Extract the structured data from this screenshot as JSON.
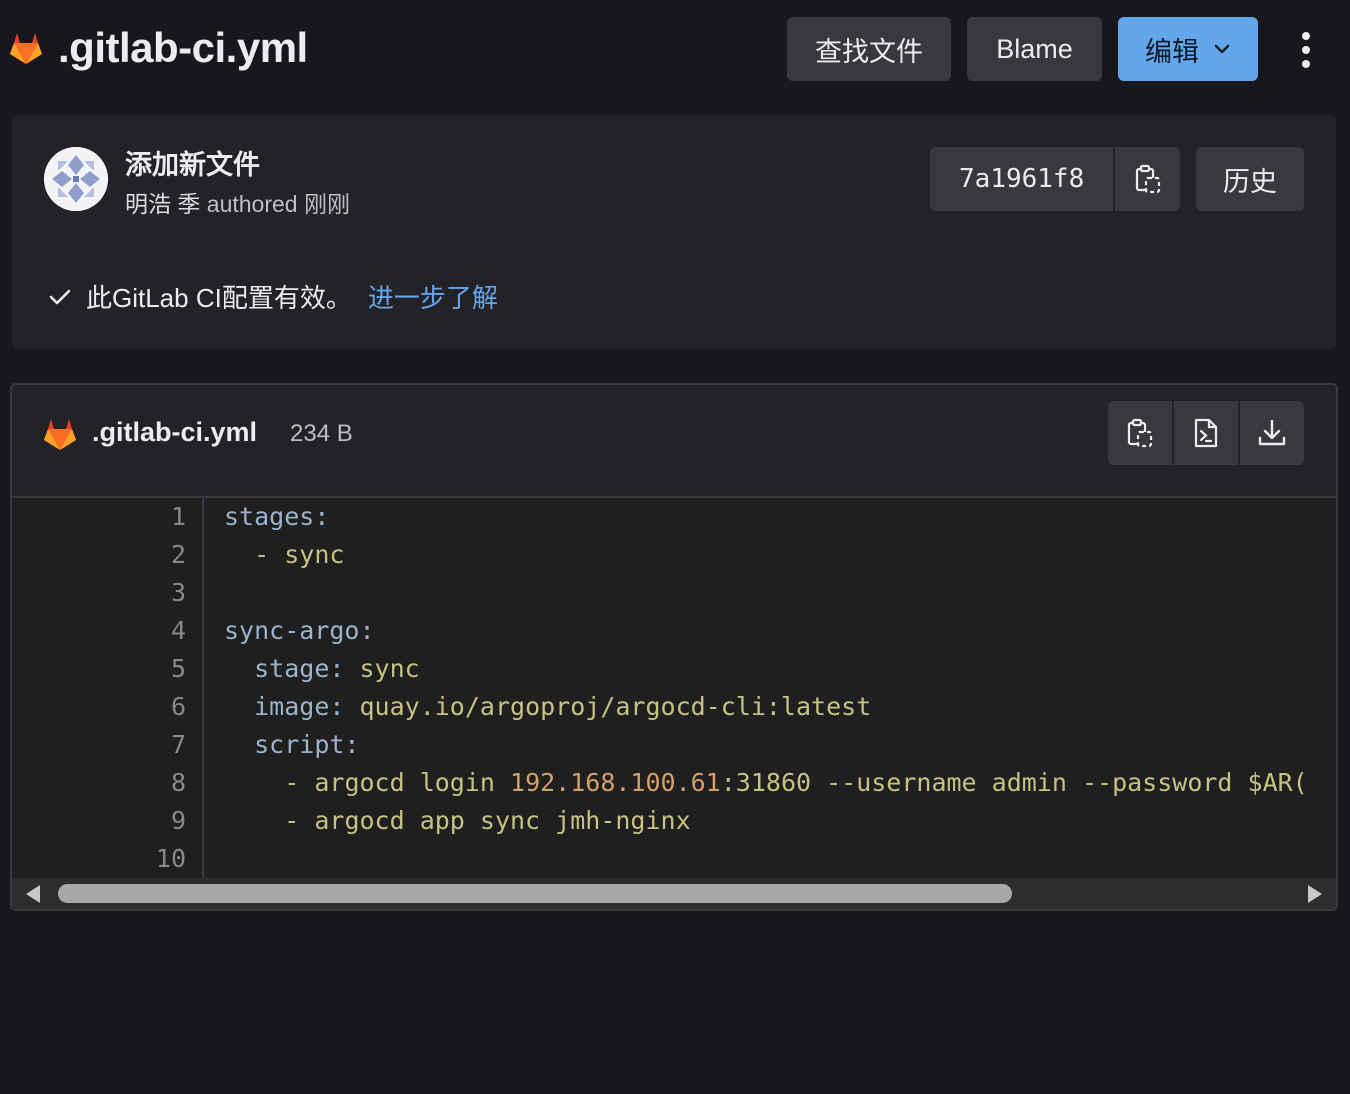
{
  "header": {
    "file_name": ".gitlab-ci.yml",
    "find_file_label": "查找文件",
    "blame_label": "Blame",
    "edit_label": "编辑"
  },
  "commit": {
    "title": "添加新文件",
    "author": "明浩 季",
    "authored_word": "authored",
    "time": "刚刚",
    "sha": "7a1961f8",
    "history_label": "历史"
  },
  "ci_status": {
    "message": "此GitLab CI配置有效。",
    "link_label": "进一步了解"
  },
  "file": {
    "name": ".gitlab-ci.yml",
    "size": "234 B",
    "line_numbers": [
      "1",
      "2",
      "3",
      "4",
      "5",
      "6",
      "7",
      "8",
      "9",
      "10"
    ],
    "lines": [
      [
        {
          "t": "key",
          "v": "stages"
        },
        {
          "t": "key",
          "v": ":"
        }
      ],
      [
        {
          "t": "plain",
          "v": "  "
        },
        {
          "t": "punct",
          "v": "-"
        },
        {
          "t": "plain",
          "v": " "
        },
        {
          "t": "str",
          "v": "sync"
        }
      ],
      [],
      [
        {
          "t": "key",
          "v": "sync-argo"
        },
        {
          "t": "key",
          "v": ":"
        }
      ],
      [
        {
          "t": "plain",
          "v": "  "
        },
        {
          "t": "key",
          "v": "stage"
        },
        {
          "t": "key",
          "v": ":"
        },
        {
          "t": "plain",
          "v": " "
        },
        {
          "t": "str",
          "v": "sync"
        }
      ],
      [
        {
          "t": "plain",
          "v": "  "
        },
        {
          "t": "key",
          "v": "image"
        },
        {
          "t": "key",
          "v": ":"
        },
        {
          "t": "plain",
          "v": " "
        },
        {
          "t": "str",
          "v": "quay.io/argoproj/argocd-cli:latest"
        }
      ],
      [
        {
          "t": "plain",
          "v": "  "
        },
        {
          "t": "key",
          "v": "script"
        },
        {
          "t": "key",
          "v": ":"
        }
      ],
      [
        {
          "t": "plain",
          "v": "    "
        },
        {
          "t": "punct",
          "v": "-"
        },
        {
          "t": "plain",
          "v": " "
        },
        {
          "t": "str",
          "v": "argocd login "
        },
        {
          "t": "num",
          "v": "192.168.100.61"
        },
        {
          "t": "str",
          "v": ":31860 --username admin --password $AR("
        }
      ],
      [
        {
          "t": "plain",
          "v": "    "
        },
        {
          "t": "punct",
          "v": "-"
        },
        {
          "t": "plain",
          "v": " "
        },
        {
          "t": "str",
          "v": "argocd app sync jmh-nginx"
        }
      ],
      []
    ]
  },
  "icons": {
    "logo": "gitlab-tanuki-icon",
    "copy": "copy-to-clipboard-icon",
    "raw": "open-raw-icon",
    "download": "download-icon",
    "check": "check-icon",
    "chevron": "chevron-down-icon",
    "kebab": "more-actions-icon"
  },
  "colors": {
    "background": "#18171d",
    "panel": "#232228",
    "button": "#3a383f",
    "accent": "#63a6e9",
    "tanuki": "#e24329"
  }
}
